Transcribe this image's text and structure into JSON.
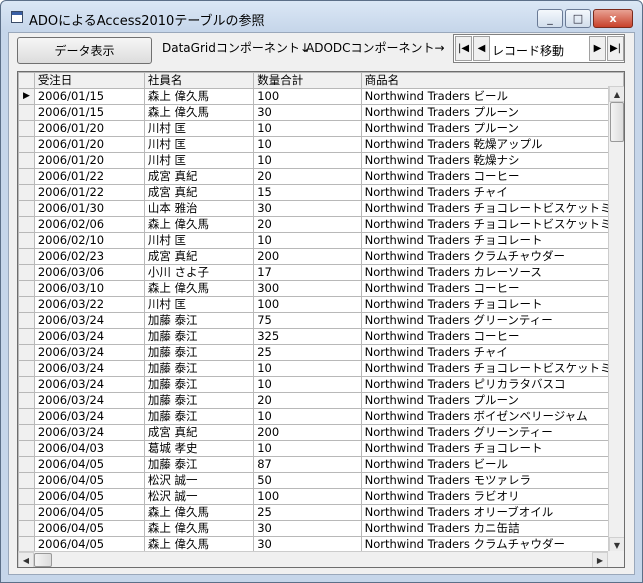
{
  "window": {
    "title": "ADOによるAccess2010テーブルの参照",
    "minimize_label": "_",
    "maximize_label": "□",
    "close_label": "x"
  },
  "toolbar": {
    "show_data_label": "データ表示",
    "datagrid_label": "DataGridコンポーネント↓",
    "adodc_label": "ADODCコンポーネント→"
  },
  "adodc": {
    "caption": "レコード移動",
    "first_label": "|◀",
    "prev_label": "◀",
    "next_label": "▶",
    "last_label": "▶|"
  },
  "grid": {
    "columns": [
      "受注日",
      "社員名",
      "数量合計",
      "商品名"
    ],
    "current_row_marker": "▶",
    "rows": [
      [
        "2006/01/15",
        "森上 偉久馬",
        "100",
        "Northwind Traders ビール"
      ],
      [
        "2006/01/15",
        "森上 偉久馬",
        "30",
        "Northwind Traders プルーン"
      ],
      [
        "2006/01/20",
        "川村 匡",
        "10",
        "Northwind Traders プルーン"
      ],
      [
        "2006/01/20",
        "川村 匡",
        "10",
        "Northwind Traders 乾燥アップル"
      ],
      [
        "2006/01/20",
        "川村 匡",
        "10",
        "Northwind Traders 乾燥ナシ"
      ],
      [
        "2006/01/22",
        "成宮 真紀",
        "20",
        "Northwind Traders コーヒー"
      ],
      [
        "2006/01/22",
        "成宮 真紀",
        "15",
        "Northwind Traders チャイ"
      ],
      [
        "2006/01/30",
        "山本 雅治",
        "30",
        "Northwind Traders チョコレートビスケットミッ"
      ],
      [
        "2006/02/06",
        "森上 偉久馬",
        "20",
        "Northwind Traders チョコレートビスケットミッ"
      ],
      [
        "2006/02/10",
        "川村 匡",
        "10",
        "Northwind Traders チョコレート"
      ],
      [
        "2006/02/23",
        "成宮 真紀",
        "200",
        "Northwind Traders クラムチャウダー"
      ],
      [
        "2006/03/06",
        "小川 さよ子",
        "17",
        "Northwind Traders カレーソース"
      ],
      [
        "2006/03/10",
        "森上 偉久馬",
        "300",
        "Northwind Traders コーヒー"
      ],
      [
        "2006/03/22",
        "川村 匡",
        "100",
        "Northwind Traders チョコレート"
      ],
      [
        "2006/03/24",
        "加藤 泰江",
        "75",
        "Northwind Traders グリーンティー"
      ],
      [
        "2006/03/24",
        "加藤 泰江",
        "325",
        "Northwind Traders コーヒー"
      ],
      [
        "2006/03/24",
        "加藤 泰江",
        "25",
        "Northwind Traders チャイ"
      ],
      [
        "2006/03/24",
        "加藤 泰江",
        "10",
        "Northwind Traders チョコレートビスケットミッ"
      ],
      [
        "2006/03/24",
        "加藤 泰江",
        "10",
        "Northwind Traders ピリカラタバスコ"
      ],
      [
        "2006/03/24",
        "加藤 泰江",
        "20",
        "Northwind Traders プルーン"
      ],
      [
        "2006/03/24",
        "加藤 泰江",
        "10",
        "Northwind Traders ボイゼンベリージャム"
      ],
      [
        "2006/03/24",
        "成宮 真紀",
        "200",
        "Northwind Traders グリーンティー"
      ],
      [
        "2006/04/03",
        "葛城 孝史",
        "10",
        "Northwind Traders チョコレート"
      ],
      [
        "2006/04/05",
        "加藤 泰江",
        "87",
        "Northwind Traders ビール"
      ],
      [
        "2006/04/05",
        "松沢 誠一",
        "50",
        "Northwind Traders モツァレラ"
      ],
      [
        "2006/04/05",
        "松沢 誠一",
        "100",
        "Northwind Traders ラビオリ"
      ],
      [
        "2006/04/05",
        "森上 偉久馬",
        "25",
        "Northwind Traders オリーブオイル"
      ],
      [
        "2006/04/05",
        "森上 偉久馬",
        "30",
        "Northwind Traders カニ缶詰"
      ],
      [
        "2006/04/05",
        "森上 偉久馬",
        "30",
        "Northwind Traders クラムチャウダー"
      ]
    ]
  },
  "scrollbars": {
    "up_arrow": "▲",
    "down_arrow": "▼",
    "left_arrow": "◀",
    "right_arrow": "▶"
  }
}
